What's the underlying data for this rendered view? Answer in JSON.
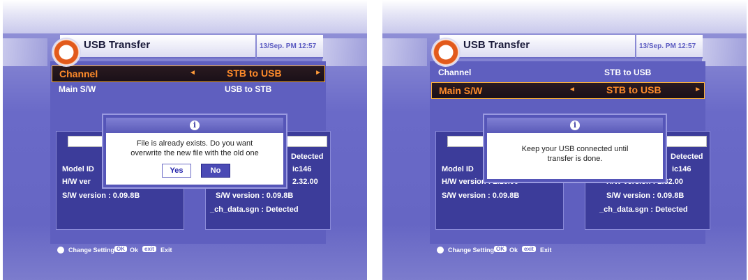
{
  "left_screen": {
    "title": "USB Transfer",
    "clock": "13/Sep. PM 12:57",
    "menu": [
      {
        "label": "Channel",
        "value": "STB to USB",
        "selected": true
      },
      {
        "label": "Main S/W",
        "value": "USB to STB",
        "selected": false
      }
    ],
    "info_left": {
      "model": "Model ID",
      "hw": "H/W ver",
      "sw": "S/W version : 0.09.8B"
    },
    "info_right": {
      "detected": "Detected",
      "model": "ic146",
      "hw": "2.32.00",
      "sw": "S/W version : 0.09.8B",
      "ch": "_ch_data.sgn : Detected"
    },
    "dialog": {
      "line1": "File is already exists. Do you want",
      "line2": "overwrite the new file with the old one",
      "yes": "Yes",
      "no": "No",
      "selected": "No"
    },
    "footer": {
      "change": "Change Setting",
      "ok_key": "OK",
      "ok": "Ok",
      "exit_key": "exit",
      "exit": "Exit"
    }
  },
  "right_screen": {
    "title": "USB Transfer",
    "clock": "13/Sep. PM 12:57",
    "menu": [
      {
        "label": "Channel",
        "value": "STB to USB",
        "selected": false
      },
      {
        "label": "Main S/W",
        "value": "STB to USB",
        "selected": true
      }
    ],
    "info_left": {
      "model": "Model ID",
      "hw": "H/W version : 2.16.00",
      "sw": "S/W version : 0.09.8B"
    },
    "info_right": {
      "detected": "Detected",
      "model": "ic146",
      "hw": "H/W version : 2.32.00",
      "sw": "S/W version : 0.09.8B",
      "ch": "_ch_data.sgn : Detected"
    },
    "dialog": {
      "line1": "Keep your USB connected until",
      "line2": "transfer is done."
    },
    "footer": {
      "change": "Change Setting",
      "ok_key": "OK",
      "ok": "Ok",
      "exit_key": "exit",
      "exit": "Exit"
    }
  },
  "colors": {
    "accent": "#ff8b2a",
    "panel": "#5f5fbf",
    "dialog_border": "#5555b8"
  },
  "icons": {
    "logo": "refresh-circle-icon",
    "info": "info-icon",
    "arrows": "triangle-arrow-icon"
  }
}
